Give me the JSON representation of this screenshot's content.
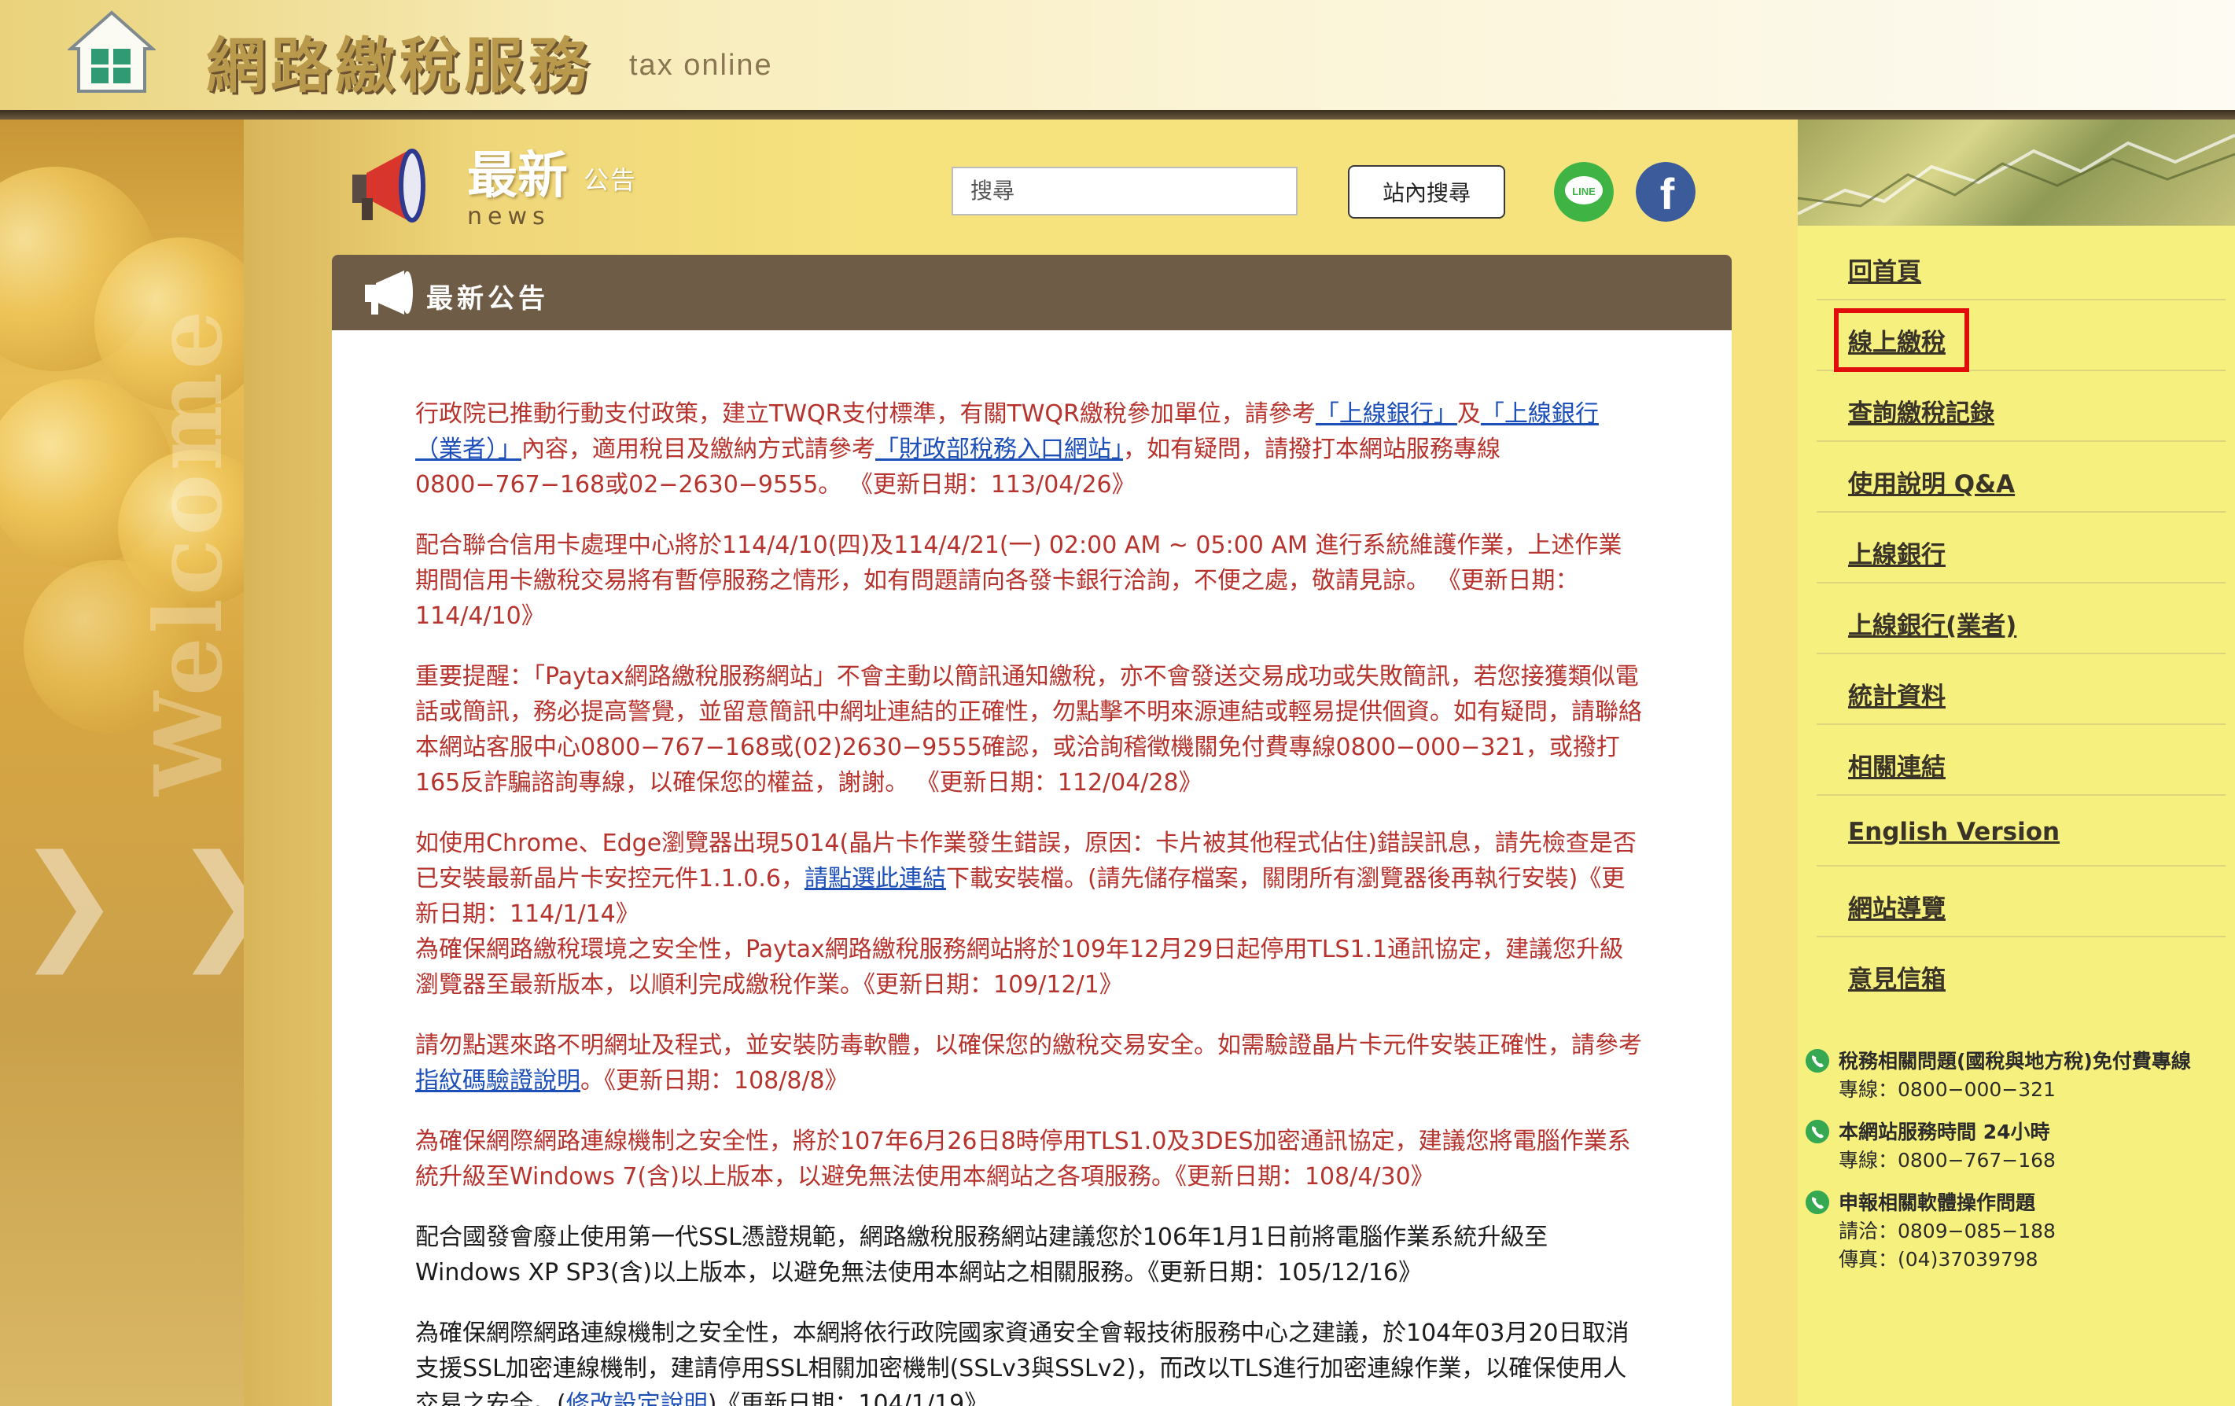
{
  "header": {
    "site_title": "網路繳稅服務",
    "site_subtitle": "tax online"
  },
  "news_header": {
    "title": "最新",
    "title_small": "公告",
    "title_en": "news"
  },
  "search": {
    "placeholder": "搜尋",
    "button_label": "站內搜尋"
  },
  "social": {
    "line_label": "LINE",
    "facebook_label": "f"
  },
  "left_deco": {
    "welcome_text": "Welcome"
  },
  "panel": {
    "title": "最新公告"
  },
  "news": [
    {
      "color": "red",
      "t1": "行政院已推動行動支付政策，建立TWQR支付標準，有關TWQR繳稅參加單位，請參考",
      "link1": "「上線銀行」",
      "t2": "及",
      "link2": "「上線銀行（業者）」",
      "t3": "內容，適用稅目及繳納方式請參考",
      "link3": "「財政部稅務入口網站」",
      "t4": "，如有疑問，請撥打本網站服務專線0800−767−168或02−2630−9555。 《更新日期：113/04/26》"
    },
    {
      "color": "red",
      "text": "配合聯合信用卡處理中心將於114/4/10(四)及114/4/21(一) 02:00 AM ~ 05:00 AM 進行系統維護作業，上述作業期間信用卡繳稅交易將有暫停服務之情形，如有問題請向各發卡銀行洽詢，不便之處，敬請見諒。 《更新日期：114/4/10》"
    },
    {
      "color": "red",
      "text": "重要提醒：「Paytax網路繳稅服務網站」不會主動以簡訊通知繳稅，亦不會發送交易成功或失敗簡訊，若您接獲類似電話或簡訊，務必提高警覺，並留意簡訊中網址連結的正確性，勿點擊不明來源連結或輕易提供個資。如有疑問，請聯絡本網站客服中心0800−767−168或(02)2630−9555確認，或洽詢稽徵機關免付費專線0800−000−321，或撥打165反詐騙諮詢專線，以確保您的權益，謝謝。 《更新日期：112/04/28》"
    },
    {
      "color": "red",
      "t1": "如使用Chrome、Edge瀏覽器出現5014(晶片卡作業發生錯誤，原因：卡片被其他程式佔住)錯誤訊息，請先檢查是否已安裝最新晶片卡安控元件1.1.0.6，",
      "link1": "請點選此連結",
      "t2": "下載安裝檔。(請先儲存檔案，關閉所有瀏覽器後再執行安裝)《更新日期：114/1/14》"
    },
    {
      "color": "red",
      "text": "為確保網路繳稅環境之安全性，Paytax網路繳稅服務網站將於109年12月29日起停用TLS1.1通訊協定，建議您升級瀏覽器至最新版本，以順利完成繳稅作業。《更新日期：109/12/1》"
    },
    {
      "color": "red",
      "t1": "請勿點選來路不明網址及程式，並安裝防毒軟體，以確保您的繳稅交易安全。如需驗證晶片卡元件安裝正確性，請參考 ",
      "link1": "指紋碼驗證說明",
      "t2": "。《更新日期：108/8/8》"
    },
    {
      "color": "red",
      "text": "為確保網際網路連線機制之安全性，將於107年6月26日8時停用TLS1.0及3DES加密通訊協定，建議您將電腦作業系統升級至Windows 7(含)以上版本，以避免無法使用本網站之各項服務。《更新日期：108/4/30》"
    },
    {
      "color": "black",
      "text": "配合國發會廢止使用第一代SSL憑證規範，網路繳稅服務網站建議您於106年1月1日前將電腦作業系統升級至Windows XP SP3(含)以上版本，以避免無法使用本網站之相關服務。《更新日期：105/12/16》"
    },
    {
      "color": "black",
      "t1": "為確保網際網路連線機制之安全性，本網將依行政院國家資通安全會報技術服務中心之建議，於104年03月20日取消支援SSL加密連線機制，建請停用SSL相關加密機制(SSLv3與SSLv2)，而改以TLS進行加密連線作業，以確保使用人交易之安全。(",
      "link1": "修改設定說明",
      "t2": ")《更新日期：104/1/19》"
    }
  ],
  "sidebar": {
    "items": [
      "回首頁",
      "線上繳稅",
      "查詢繳稅記錄",
      "使用說明 Q&A",
      "上線銀行",
      "上線銀行(業者)",
      "統計資料",
      "相關連結",
      "English Version",
      "網站導覽",
      "意見信箱"
    ],
    "highlighted_index": 1
  },
  "contacts": [
    {
      "title": "稅務相關問題(國稅與地方稅)免付費專線",
      "line1": "專線：0800−000−321"
    },
    {
      "title": "本網站服務時間 24小時",
      "line1": "專線：0800−767−168"
    },
    {
      "title": "申報相關軟體操作問題",
      "line1": "請洽：0809−085−188",
      "line2": "傳真：(04)37039798"
    }
  ],
  "colors": {
    "news_red": "#b7332d",
    "link_blue": "#1d4fb8",
    "panel_header": "#6f5c46",
    "highlight_red": "#e10d0d",
    "sidebar_bg": "#f6f07e"
  }
}
